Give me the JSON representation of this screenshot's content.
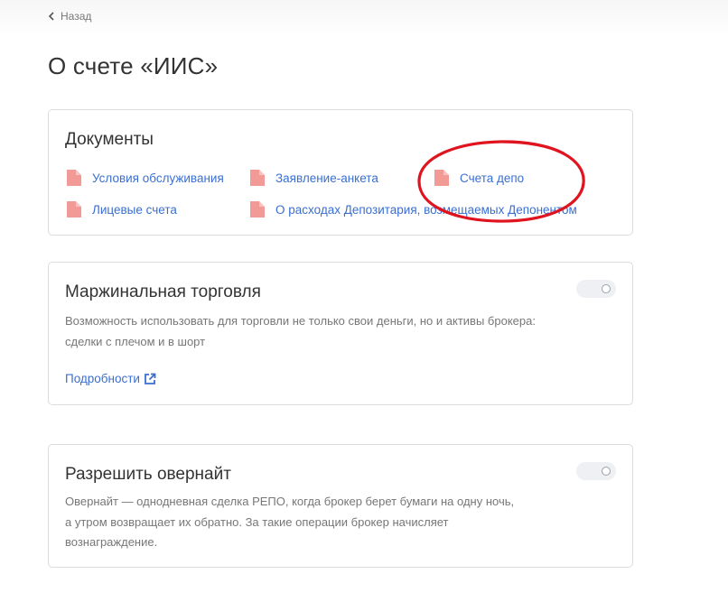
{
  "nav": {
    "back_label": "Назад"
  },
  "page": {
    "title": "О счете «ИИС»"
  },
  "documents": {
    "title": "Документы",
    "items": [
      {
        "label": "Условия обслуживания"
      },
      {
        "label": "Заявление-анкета"
      },
      {
        "label": "Счета депо"
      },
      {
        "label": "Лицевые счета"
      },
      {
        "label": "О расходах Депозитария, возмещаемых Депонентом"
      }
    ]
  },
  "margin_trading": {
    "title": "Маржинальная торговля",
    "description": [
      "Возможность использовать для торговли не только свои деньги, но и активы брокера:",
      "сделки с плечом и в шорт"
    ],
    "more_label": "Подробности",
    "enabled": false
  },
  "overnight": {
    "title": "Разрешить овернайт",
    "description": [
      "Овернайт — однодневная сделка РЕПО, когда брокер берет бумаги на одну ночь,",
      "а утром возвращает их обратно. За такие операции брокер начисляет",
      "вознаграждение."
    ],
    "enabled": false
  },
  "colors": {
    "link": "#3a6fd1",
    "doc_icon": "#f29a96",
    "annotation": "#e0141e"
  }
}
